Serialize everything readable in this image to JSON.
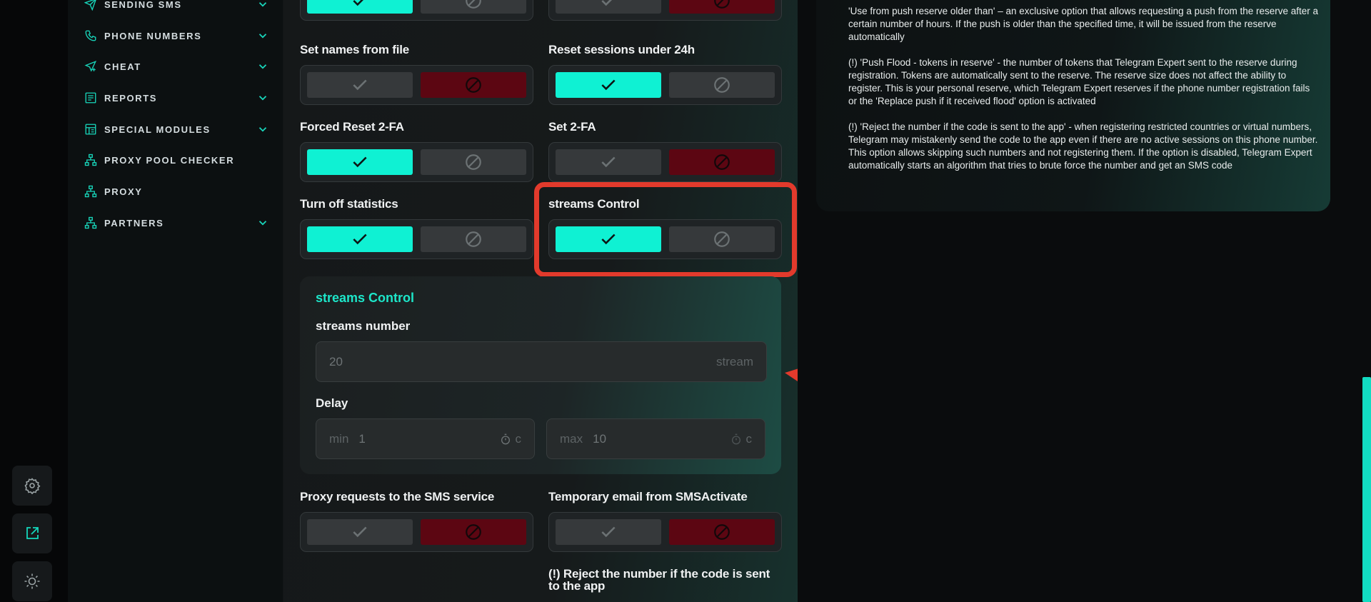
{
  "sidebar": {
    "items": [
      {
        "label": "SENDING SMS",
        "icon": "paper-plane-icon",
        "has_chevron": true
      },
      {
        "label": "PHONE NUMBERS",
        "icon": "phone-icon",
        "has_chevron": true
      },
      {
        "label": "CHEAT",
        "icon": "send-plus-icon",
        "has_chevron": true
      },
      {
        "label": "REPORTS",
        "icon": "report-icon",
        "has_chevron": true
      },
      {
        "label": "SPECIAL MODULES",
        "icon": "modules-icon",
        "has_chevron": true
      },
      {
        "label": "PROXY POOL CHECKER",
        "icon": "network-icon",
        "has_chevron": false
      },
      {
        "label": "PROXY",
        "icon": "network-icon",
        "has_chevron": false
      },
      {
        "label": "PARTNERS",
        "icon": "network-icon",
        "has_chevron": true
      }
    ]
  },
  "rail": {
    "buttons": [
      {
        "icon": "gear-icon"
      },
      {
        "icon": "external-link-icon"
      },
      {
        "icon": "theme-toggle-icon"
      }
    ]
  },
  "options": {
    "top_left": {
      "state": "yes"
    },
    "top_right": {
      "state": "no"
    },
    "set_names": {
      "label": "Set names from file",
      "state": "no"
    },
    "reset_sessions": {
      "label": "Reset sessions under 24h",
      "state": "yes"
    },
    "forced_reset": {
      "label": "Forced Reset 2-FA",
      "state": "yes"
    },
    "set_2fa": {
      "label": "Set 2-FA",
      "state": "no"
    },
    "turn_off_stats": {
      "label": "Turn off statistics",
      "state": "yes"
    },
    "streams_control": {
      "label": "streams Control",
      "state": "yes"
    },
    "proxy_requests": {
      "label": "Proxy requests to the SMS service",
      "state": "no"
    },
    "temp_email": {
      "label": "Temporary email from SMSActivate",
      "state": "no"
    },
    "reject_number": {
      "label": "(!) Reject the number if the code is sent to the app"
    }
  },
  "streams_box": {
    "title": "streams Control",
    "streams_number_label": "streams number",
    "streams_number_value": "20",
    "streams_number_suffix": "stream",
    "delay_label": "Delay",
    "delay_min_prefix": "min",
    "delay_min_value": "1",
    "delay_max_prefix": "max",
    "delay_max_value": "10",
    "delay_unit": "c"
  },
  "info": {
    "paragraphs": [
      "'Use from push reserve older than' – an exclusive option that allows requesting a push from the reserve after a certain number of hours. If the push is older than the specified time, it will be issued from the reserve automatically",
      "(!) 'Push Flood - tokens in reserve' - the number of tokens that Telegram Expert sent to the reserve during registration. Tokens are automatically sent to the reserve. The reserve size does not affect the ability to register. This is your personal reserve, which Telegram Expert reserves if the phone number registration fails or the 'Replace push if it received flood' option is activated",
      "(!) 'Reject the number if the code is sent to the app' - when registering restricted countries or virtual numbers, Telegram may mistakenly send the code to the app even if there are no active sessions on this phone number. This option allows skipping such numbers and not registering them. If the option is disabled, Telegram Expert automatically starts an algorithm that tries to brute force the number and get an SMS code"
    ]
  },
  "colors": {
    "accent": "#0ff1d3",
    "reject_active": "#5c0612",
    "highlight": "#e23a2c"
  }
}
